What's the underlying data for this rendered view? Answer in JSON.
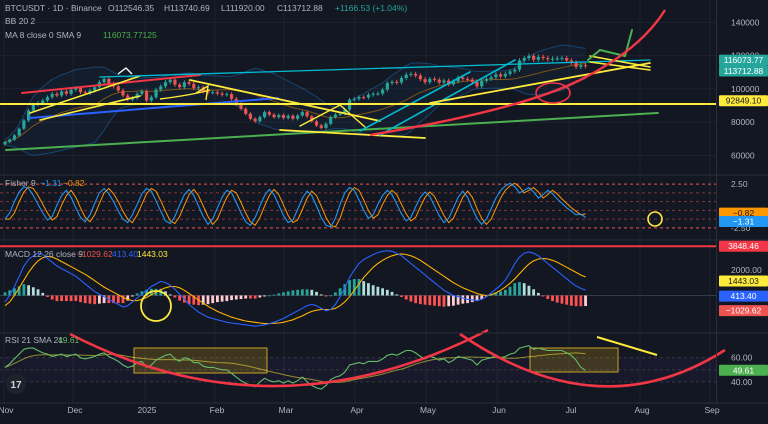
{
  "header": {
    "symbol": "BTCUSDT",
    "interval": "1D",
    "exchange": "Binance",
    "open": "O112546.35",
    "high": "H113740.69",
    "low": "L111920.00",
    "close": "C113712.88",
    "change": "+1166.53 (+1.04%)",
    "bb_label": "BB 20 2",
    "ma_label": "MA 8 close 0 SMA 9",
    "ma_value": "116073.77125"
  },
  "fisher": {
    "label": "Fisher 9",
    "v1": "−1.31",
    "v2": "−0.82"
  },
  "macd": {
    "label": "MACD 12 26 close 9",
    "hist": "−1029.62",
    "macd": "413.40",
    "signal": "1443.03"
  },
  "rsi": {
    "label": "RSI 21 SMA 21",
    "value": "49.61"
  },
  "colors": {
    "bg": "#131722",
    "up": "#26a69a",
    "down": "#ef5350",
    "yellow": "#ffeb3b",
    "red": "#f23645",
    "green": "#4caf50",
    "cyan": "#00bcd4",
    "blue": "#2962ff",
    "fisher": "#2196f3",
    "fisher_sig": "#ff9800",
    "rsi": "#66bb6a",
    "lime": "#4caf50"
  },
  "chart_data": [
    {
      "type": "candlestick",
      "name": "price",
      "x_ticks": [
        "Nov",
        "Dec",
        "2025",
        "Feb",
        "Mar",
        "Apr",
        "May",
        "Jun",
        "Jul",
        "Aug",
        "Sep"
      ],
      "y_ticks": [
        140000,
        120000,
        100000,
        80000,
        60000
      ],
      "y_range": [
        50000,
        145000
      ],
      "markers": [
        {
          "label": "116073.77",
          "value": 116073.77,
          "color": "#26a69a"
        },
        {
          "label": "113712.88",
          "value": 113712.88,
          "color": "#26a69a"
        },
        {
          "label": "92849.10",
          "value": 92849.1,
          "color": "#ffeb3b"
        }
      ],
      "closes": [
        68000,
        69500,
        72000,
        76000,
        81000,
        87000,
        90500,
        91500,
        93000,
        95000,
        97000,
        96000,
        98500,
        97000,
        99500,
        100500,
        98000,
        97500,
        99000,
        101000,
        104000,
        106000,
        103000,
        101500,
        99000,
        96000,
        93500,
        94500,
        97000,
        98500,
        93000,
        95000,
        99500,
        101500,
        104000,
        105500,
        102500,
        101000,
        104000,
        103000,
        100500,
        101000,
        98500,
        97800,
        98000,
        97200,
        96500,
        96800,
        94000,
        91000,
        88000,
        85000,
        82000,
        80500,
        83000,
        86000,
        84500,
        83000,
        84200,
        82500,
        83800,
        82000,
        84000,
        86000,
        83500,
        80500,
        78000,
        76500,
        79000,
        83000,
        84500,
        85000,
        87500,
        93500,
        94000,
        95000,
        94800,
        96500,
        97000,
        97200,
        99500,
        103500,
        104200,
        103800,
        106500,
        108500,
        109000,
        108000,
        105800,
        104000,
        106000,
        105500,
        103800,
        105000,
        102800,
        104500,
        106800,
        106000,
        105500,
        104200,
        101500,
        104800,
        106000,
        107000,
        108700,
        107500,
        109000,
        110500,
        111500,
        117000,
        118500,
        119800,
        117500,
        119200,
        118500,
        117800,
        118100,
        118300,
        118500,
        117000,
        115800,
        113200,
        114200,
        113712
      ]
    },
    {
      "type": "line",
      "name": "fisher",
      "y_ticks": [
        2.5,
        -2.5
      ],
      "markers": [
        {
          "label": "−0.82",
          "value": -0.82,
          "color": "#ff9800"
        },
        {
          "label": "−1.31",
          "value": -1.31,
          "color": "#2196f3"
        }
      ],
      "values": [
        -1.5,
        -0.8,
        0.5,
        1.6,
        2.2,
        2.0,
        1.2,
        0.2,
        -0.8,
        -1.6,
        -1.2,
        0.1,
        1.2,
        1.8,
        1.0,
        -0.2,
        -1.3,
        -1.8,
        -1.0,
        0.3,
        1.5,
        2.0,
        1.4,
        0.5,
        -0.6,
        -1.5,
        -1.9,
        -1.0,
        0.2,
        1.4,
        2.0,
        1.7,
        0.6,
        -0.6,
        -1.7,
        -2.0,
        -1.2,
        0.1,
        1.3,
        1.9,
        1.2,
        0.0,
        -1.2,
        -2.1,
        -1.5,
        -0.2,
        1.0,
        1.8,
        1.5,
        0.4,
        -0.8,
        -1.8,
        -2.2,
        -1.3,
        0.0,
        1.2,
        1.9,
        1.3,
        0.1,
        -1.1,
        -1.9,
        -1.6,
        -0.4,
        0.9,
        1.7,
        1.2,
        0.0,
        -1.3,
        -2.2,
        -2.4,
        -1.4,
        0.2,
        1.5,
        2.1,
        1.8,
        0.7,
        -0.5,
        -1.4,
        -1.0,
        0.2,
        1.2,
        1.8,
        1.3,
        0.2,
        -0.9,
        -1.7,
        -1.3,
        -0.1,
        1.0,
        1.6,
        1.1,
        0.0,
        -1.1,
        -1.9,
        -1.4,
        -0.2,
        1.0,
        1.7,
        1.0,
        -0.3,
        -1.4,
        -2.1,
        -1.5,
        -0.3,
        0.9,
        1.8,
        2.3,
        2.6,
        2.2,
        1.5,
        1.8,
        2.1,
        1.6,
        0.9,
        1.3,
        1.8,
        1.4,
        0.8,
        0.3,
        -0.2,
        -0.6,
        -1.0,
        -0.9,
        -1.31
      ]
    },
    {
      "type": "bar+line",
      "name": "macd",
      "y_ticks": [
        2000,
        0
      ],
      "markers": [
        {
          "label": "3848.46",
          "value": 3848.46,
          "color": "#f23645"
        },
        {
          "label": "1443.03",
          "value": 1443.03,
          "color": "#ffeb3b"
        },
        {
          "label": "413.40",
          "value": 413.4,
          "color": "#2962ff"
        },
        {
          "label": "−1029.62",
          "value": -1029.62,
          "color": "#ef5350"
        }
      ],
      "macd": [
        -500,
        0,
        700,
        1500,
        2300,
        2800,
        3100,
        3300,
        3200,
        2900,
        2600,
        2300,
        2100,
        1900,
        1700,
        1500,
        1200,
        900,
        600,
        300,
        100,
        -100,
        -300,
        -500,
        -700,
        -900,
        -800,
        -500,
        -200,
        100,
        400,
        700,
        900,
        1100,
        1000,
        800,
        500,
        100,
        -300,
        -700,
        -1000,
        -1300,
        -1500,
        -1700,
        -1800,
        -1900,
        -2000,
        -2100,
        -2150,
        -2200,
        -2250,
        -2300,
        -2350,
        -2400,
        -2350,
        -2300,
        -2200,
        -2100,
        -1950,
        -1800,
        -1600,
        -1400,
        -1200,
        -1000,
        -800,
        -700,
        -800,
        -1000,
        -1200,
        -1100,
        -700,
        -100,
        600,
        1400,
        2000,
        2500,
        2800,
        3000,
        3200,
        3350,
        3450,
        3500,
        3450,
        3300,
        3100,
        2800,
        2500,
        2200,
        1900,
        1600,
        1300,
        1000,
        700,
        400,
        200,
        0,
        -100,
        -200,
        -300,
        -350,
        -400,
        -300,
        -100,
        200,
        500,
        800,
        1200,
        1800,
        2500,
        3000,
        3300,
        3400,
        3300,
        3100,
        2800,
        2500,
        2200,
        1900,
        1600,
        1300,
        1000,
        750,
        550,
        413.4
      ],
      "signal": [
        -800,
        -500,
        0,
        600,
        1200,
        1800,
        2300,
        2700,
        2950,
        3050,
        3000,
        2850,
        2650,
        2450,
        2250,
        2050,
        1850,
        1650,
        1400,
        1150,
        900,
        650,
        450,
        250,
        50,
        -150,
        -300,
        -400,
        -400,
        -300,
        -150,
        50,
        250,
        450,
        600,
        700,
        700,
        600,
        400,
        150,
        -100,
        -350,
        -600,
        -850,
        -1050,
        -1250,
        -1400,
        -1550,
        -1700,
        -1800,
        -1900,
        -2000,
        -2050,
        -2100,
        -2150,
        -2200,
        -2200,
        -2180,
        -2150,
        -2100,
        -2000,
        -1900,
        -1750,
        -1600,
        -1400,
        -1250,
        -1150,
        -1100,
        -1100,
        -1100,
        -1000,
        -800,
        -500,
        -100,
        400,
        900,
        1400,
        1800,
        2200,
        2500,
        2750,
        2950,
        3100,
        3200,
        3250,
        3200,
        3100,
        2950,
        2750,
        2500,
        2250,
        2000,
        1750,
        1500,
        1250,
        1000,
        800,
        600,
        450,
        300,
        150,
        50,
        0,
        50,
        200,
        400,
        650,
        950,
        1300,
        1700,
        2100,
        2450,
        2700,
        2850,
        2900,
        2850,
        2750,
        2600,
        2400,
        2200,
        2000,
        1800,
        1600,
        1443.03
      ]
    },
    {
      "type": "line",
      "name": "rsi",
      "y_ticks": [
        60,
        40
      ],
      "markers": [
        {
          "label": "49.61",
          "value": 49.61,
          "color": "#4caf50"
        }
      ],
      "values": [
        52,
        55,
        59,
        63,
        67,
        68,
        68,
        66,
        64,
        63,
        61,
        62,
        63,
        61,
        62,
        63,
        60,
        59,
        60,
        61,
        63,
        64,
        61,
        59,
        57,
        54,
        52,
        53,
        56,
        57,
        52,
        54,
        58,
        60,
        62,
        63,
        59,
        57,
        60,
        59,
        56,
        56,
        53,
        52,
        52,
        51,
        50,
        50,
        47,
        44,
        41,
        39,
        37,
        36,
        40,
        43,
        41,
        40,
        41,
        39,
        41,
        39,
        41,
        44,
        40,
        37,
        35,
        34,
        37,
        42,
        44,
        45,
        48,
        54,
        55,
        56,
        55,
        57,
        57,
        57,
        59,
        62,
        63,
        62,
        64,
        66,
        66,
        64,
        61,
        59,
        61,
        60,
        58,
        59,
        56,
        58,
        61,
        60,
        59,
        58,
        54,
        58,
        59,
        60,
        62,
        60,
        61,
        63,
        64,
        68,
        69,
        70,
        67,
        68,
        67,
        66,
        66,
        66,
        66,
        64,
        62,
        58,
        52,
        49.61
      ]
    }
  ]
}
